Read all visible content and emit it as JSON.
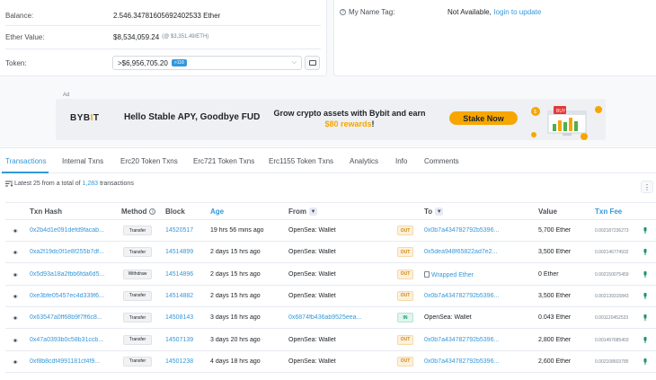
{
  "overview": {
    "balance_label": "Balance:",
    "balance_value": "2.546.34781605692402533 Ether",
    "ether_value_label": "Ether Value:",
    "ether_value": "$8,534,059.24",
    "ether_rate": "(@ $3,351.49/ETH)",
    "token_label": "Token:",
    "token_value": ">$6,956,705.20",
    "token_badge": ">118"
  },
  "more_info": {
    "name_tag_label": "My Name Tag:",
    "name_tag_value": "Not Available,",
    "name_tag_link": "login to update"
  },
  "ad": {
    "tag": "Ad",
    "logo_prefix": "BYB",
    "logo_accent": "I",
    "logo_suffix": "T",
    "headline": "Hello Stable APY, Goodbye FUD",
    "promo_line1": "Grow crypto assets with Bybit and earn",
    "promo_highlight": "$80 rewards",
    "promo_end": "!",
    "cta": "Stake Now",
    "art_label": "BUY"
  },
  "tabs": [
    "Transactions",
    "Internal Txns",
    "Erc20 Token Txns",
    "Erc721 Token Txns",
    "Erc1155 Token Txns",
    "Analytics",
    "Info",
    "Comments"
  ],
  "summary": {
    "prefix": "Latest 25 from a total of",
    "count": "1,283",
    "suffix": "transactions"
  },
  "kebab": "⋮",
  "table": {
    "headers": {
      "hash": "Txn Hash",
      "method": "Method",
      "block": "Block",
      "age": "Age",
      "from": "From",
      "to": "To",
      "value": "Value",
      "fee": "Txn Fee"
    },
    "rows": [
      {
        "hash": "0x2b4d1e091defd9facab...",
        "method": "Transfer",
        "block": "14520517",
        "age": "19 hrs 56 mins ago",
        "from": "OpenSea: Wallet",
        "from_link": false,
        "dir": "OUT",
        "to": "0x0b7a434782792b5396...",
        "to_link": true,
        "to_contract": false,
        "value": "5,700 Ether",
        "fee": "0.002187236273"
      },
      {
        "hash": "0xa2f19dc0f1e8f255b7df...",
        "method": "Transfer",
        "block": "14514899",
        "age": "2 days 15 hrs ago",
        "from": "OpenSea: Wallet",
        "from_link": false,
        "dir": "OUT",
        "to": "0x5dea948f65822ad7e2...",
        "to_link": true,
        "to_contract": false,
        "value": "3,500 Ether",
        "fee": "0.002146774932"
      },
      {
        "hash": "0x5d93a18a2fbb6fda6d5...",
        "method": "Withdraw",
        "block": "14514896",
        "age": "2 days 15 hrs ago",
        "from": "OpenSea: Wallet",
        "from_link": false,
        "dir": "OUT",
        "to": "Wrapped Ether",
        "to_link": true,
        "to_contract": true,
        "value": "0 Ether",
        "fee": "0.002150075459"
      },
      {
        "hash": "0xe3bfe05457ec4d339f6...",
        "method": "Transfer",
        "block": "14514882",
        "age": "2 days 15 hrs ago",
        "from": "OpenSea: Wallet",
        "from_link": false,
        "dir": "OUT",
        "to": "0x0b7a434782792b5396...",
        "to_link": true,
        "to_contract": false,
        "value": "3,500 Ether",
        "fee": "0.002139315843"
      },
      {
        "hash": "0x63547a0ff68b9f7ff6c8...",
        "method": "Transfer",
        "block": "14508143",
        "age": "3 days 16 hrs ago",
        "from": "0x6874fb436ab9525eea...",
        "from_link": true,
        "dir": "IN",
        "to": "OpenSea: Wallet",
        "to_link": false,
        "to_contract": false,
        "value": "0.043 Ether",
        "fee": "0.001120452533"
      },
      {
        "hash": "0x47a0393b0c58b31ccb...",
        "method": "Transfer",
        "block": "14507139",
        "age": "3 days 20 hrs ago",
        "from": "OpenSea: Wallet",
        "from_link": false,
        "dir": "OUT",
        "to": "0x0b7a434782792b5396...",
        "to_link": true,
        "to_contract": false,
        "value": "2,800 Ether",
        "fee": "0.001497685403"
      },
      {
        "hash": "0xf8b8cdf4991181cf4f9...",
        "method": "Transfer",
        "block": "14501238",
        "age": "4 days 18 hrs ago",
        "from": "OpenSea: Wallet",
        "from_link": false,
        "dir": "OUT",
        "to": "0x0b7a434782792b5396...",
        "to_link": true,
        "to_contract": false,
        "value": "2,600 Ether",
        "fee": "0.002108603785"
      }
    ]
  },
  "colors": {
    "link": "#3498db",
    "out_badge": "#cc8b16",
    "in_badge": "#1a9270",
    "fee_dot": "#1a9270",
    "ad_accent": "#f7a600"
  },
  "icons": {
    "row_view": "eye-icon",
    "fee_indicator": "green-gas-icon",
    "filter": "filter-icon",
    "method_info": "info-circle-icon",
    "contract": "contract-file-icon",
    "sort": "sort-lines-icon",
    "wallet": "wallet-icon",
    "kebab": "more-vertical-icon"
  }
}
